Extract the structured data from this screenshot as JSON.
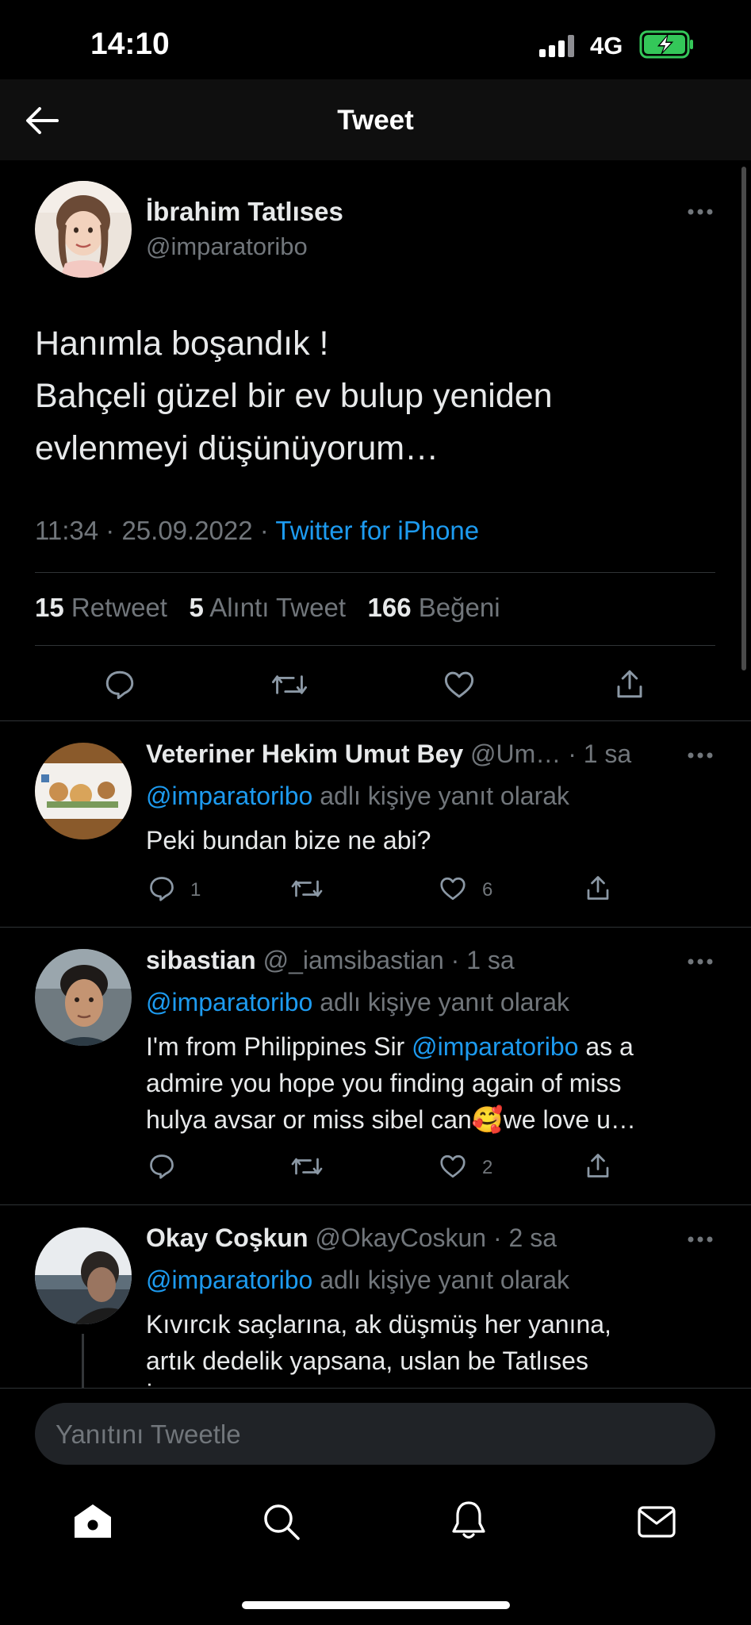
{
  "status_bar": {
    "time": "14:10",
    "network": "4G"
  },
  "header": {
    "title": "Tweet"
  },
  "main_tweet": {
    "name": "İbrahim Tatlıses",
    "handle": "@imparatoribo",
    "lines": [
      "Hanımla boşandık !",
      "Bahçeli güzel bir ev bulup yeniden",
      "evlenmeyi düşünüyorum…"
    ],
    "time": "11:34 · 25.09.2022 · ",
    "source": "Twitter for iPhone",
    "stats": {
      "retweets": "15",
      "retweets_label": "Retweet",
      "quotes": "5",
      "quotes_label": "Alıntı Tweet",
      "likes": "166",
      "likes_label": "Beğeni"
    }
  },
  "replies": [
    {
      "name": "Veteriner Hekim Umut Bey",
      "meta": "@Um… · 1 sa",
      "reply_to_handle": "@imparatoribo",
      "reply_to_text": " adlı kişiye yanıt olarak",
      "text": "Peki bundan bize ne abi?",
      "reply_count": "1",
      "like_count": "6"
    },
    {
      "name": "sibastian",
      "meta": "@_iamsibastian · 1 sa",
      "reply_to_handle": "@imparatoribo",
      "reply_to_text": " adlı kişiye yanıt olarak",
      "text_line1_a": "I'm from Philippines Sir ",
      "text_line1_mention": "@imparatoribo",
      "text_line1_b": " as a",
      "text_line2": "admire you hope you finding again of miss",
      "text_line3": "hulya avsar or miss sibel can🥰we love u…",
      "like_count": "2"
    },
    {
      "name": "Okay Coşkun",
      "meta": "@OkayCoskun · 2 sa",
      "reply_to_handle": "@imparatoribo",
      "reply_to_text": " adlı kişiye yanıt olarak",
      "text_line1": "Kıvırcık saçlarına, ak düşmüş her yanına,",
      "text_line2": "artık dedelik yapsana, uslan be Tatlıses",
      "text_line3": "İ…"
    }
  ],
  "compose": {
    "placeholder": "Yanıtını Tweetle"
  },
  "tab_bar": [
    "home-icon",
    "search-icon",
    "notifications-icon",
    "messages-icon"
  ],
  "colors": {
    "accent": "#1d9bf0",
    "muted": "#71767b",
    "background": "#000000",
    "battery": "#34c759"
  }
}
